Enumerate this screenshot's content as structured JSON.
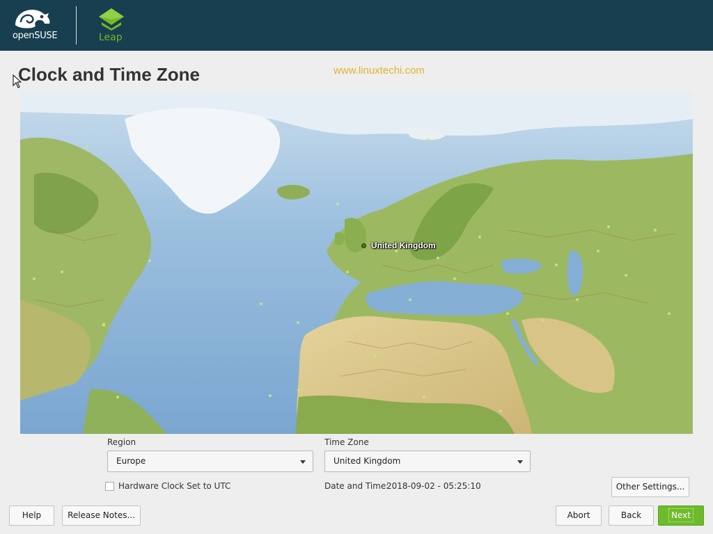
{
  "header": {
    "brand_name": "openSUSE",
    "product_name": "Leap",
    "background_color": "#173f4f",
    "accent_color": "#73ba25",
    "logo_icon": "opensuse-chameleon-icon",
    "product_icon": "leap-diamond-icon"
  },
  "page": {
    "title": "Clock and Time Zone",
    "watermark": "www.linuxtechi.com"
  },
  "map": {
    "selected_label": "United Kingdom",
    "water_color": "#8fb6d8",
    "land_color": "#9fb865"
  },
  "region": {
    "label": "Region",
    "value": "Europe"
  },
  "timezone": {
    "label": "Time Zone",
    "value": "United Kingdom"
  },
  "hardware_clock": {
    "label": "Hardware Clock Set to UTC",
    "checked": false
  },
  "datetime": {
    "label": "Date and Time:",
    "value": "2018-09-02 - 05:25:10"
  },
  "buttons": {
    "other_settings": "Other Settings...",
    "help": "Help",
    "release_notes": "Release Notes...",
    "abort": "Abort",
    "back": "Back",
    "next": "Next"
  }
}
